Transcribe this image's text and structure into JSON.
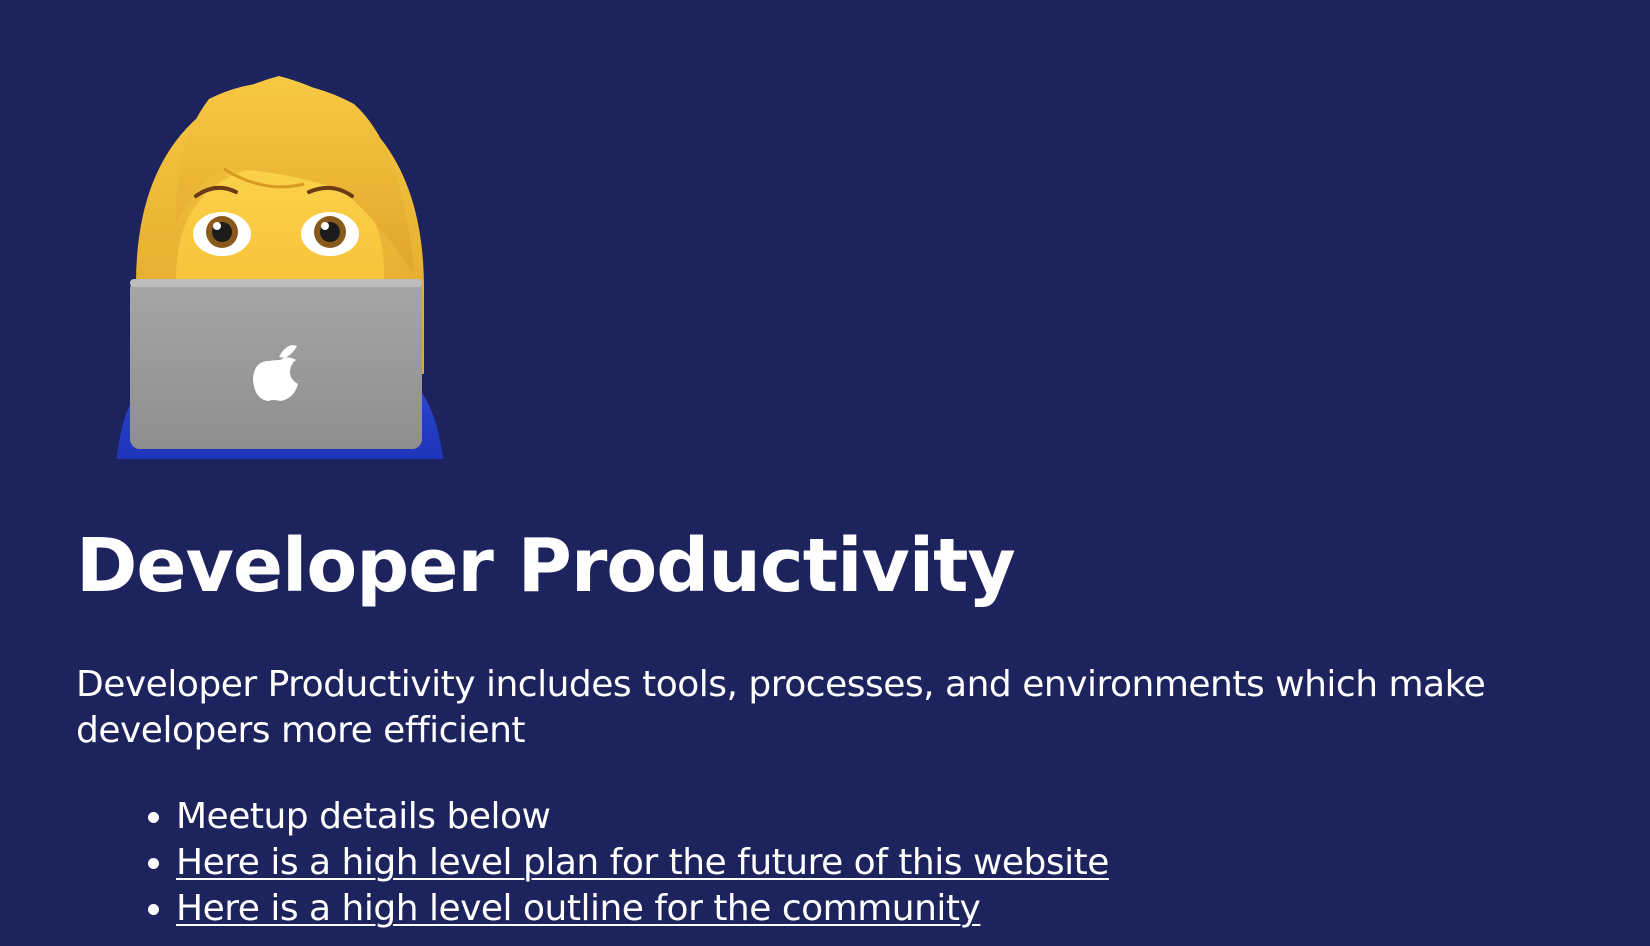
{
  "hero": {
    "icon": "woman-technologist-emoji"
  },
  "heading": "Developer Productivity",
  "description": "Developer Productivity includes tools, processes, and environments which make developers more efficient",
  "list": [
    {
      "text": "Meetup details below",
      "is_link": false
    },
    {
      "text": "Here is a high level plan for the future of this website",
      "is_link": true
    },
    {
      "text": "Here is a high level outline for the community",
      "is_link": true
    }
  ],
  "colors": {
    "background": "#1d235d",
    "text": "#ffffff"
  }
}
